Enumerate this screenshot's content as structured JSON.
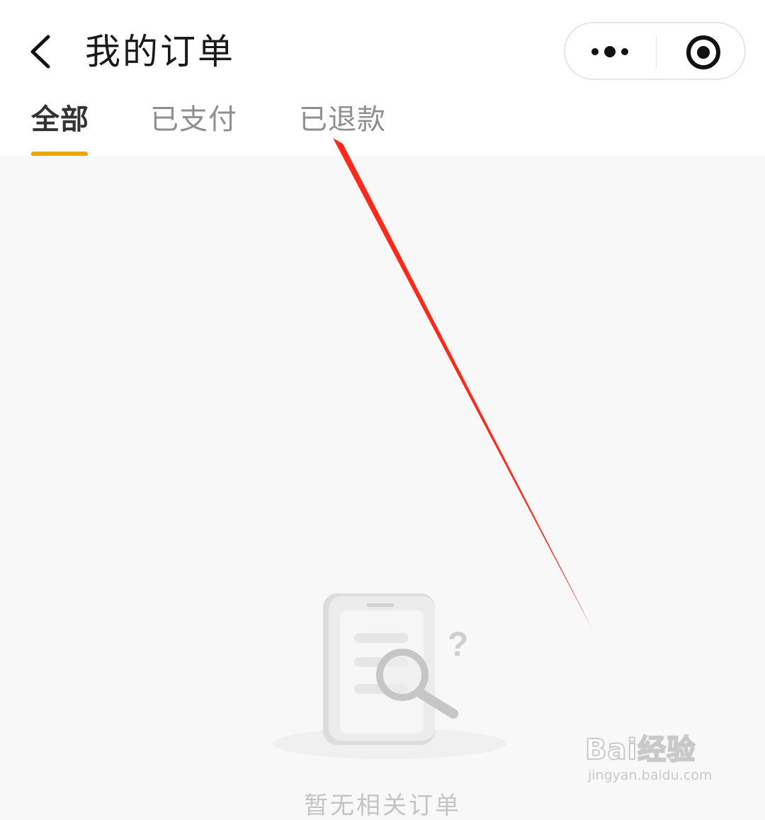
{
  "header": {
    "title": "我的订单",
    "back_icon": "chevron-left-icon",
    "capsule": {
      "more_icon": "more-dots-icon",
      "close_icon": "target-circle-icon"
    }
  },
  "tabs": [
    {
      "label": "全部",
      "active": true
    },
    {
      "label": "已支付",
      "active": false
    },
    {
      "label": "已退款",
      "active": false
    }
  ],
  "colors": {
    "accent": "#f0a500",
    "annotation_arrow": "#ff2a1a",
    "background": "#f8f8f8"
  },
  "empty_state": {
    "icon": "document-search-icon",
    "message": "暂无相关订单"
  },
  "watermark": {
    "brand": "Bai经验",
    "url": "jingyan.baidu.com"
  }
}
